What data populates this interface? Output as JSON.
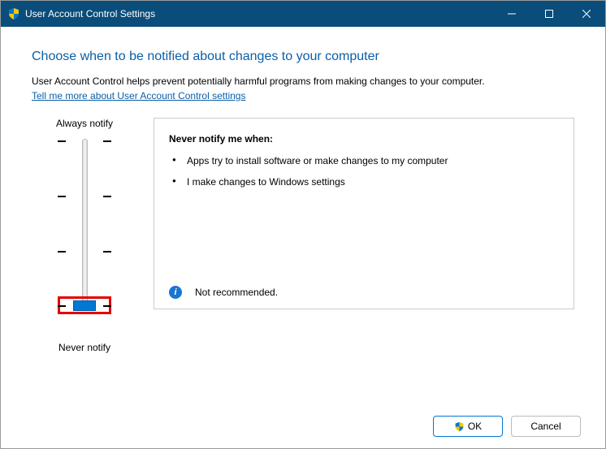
{
  "titlebar": {
    "title": "User Account Control Settings"
  },
  "content": {
    "heading": "Choose when to be notified about changes to your computer",
    "subtext": "User Account Control helps prevent potentially harmful programs from making changes to your computer.",
    "link": "Tell me more about User Account Control settings"
  },
  "slider": {
    "label_top": "Always notify",
    "label_bottom": "Never notify",
    "levels": 4,
    "current": 3
  },
  "panel": {
    "title": "Never notify me when:",
    "items": [
      "Apps try to install software or make changes to my computer",
      "I make changes to Windows settings"
    ],
    "recommendation": "Not recommended."
  },
  "buttons": {
    "ok": "OK",
    "cancel": "Cancel"
  }
}
